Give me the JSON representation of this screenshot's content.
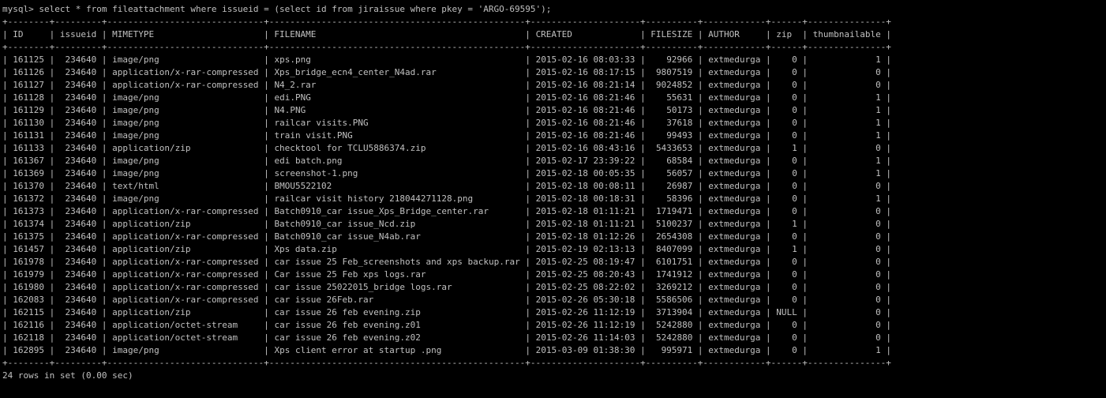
{
  "terminal": {
    "prompt": "mysql>",
    "command": "select * from fileattachment where issueid = (select id from jiraissue where pkey = 'ARGO-69595');",
    "columns": [
      "ID",
      "issueid",
      "MIMETYPE",
      "FILENAME",
      "CREATED",
      "FILESIZE",
      "AUTHOR",
      "zip",
      "thumbnailable"
    ],
    "rows": [
      [
        "161125",
        "234640",
        "image/png",
        "xps.png",
        "2015-02-16 08:03:33",
        "92966",
        "extmedurga",
        "0",
        "1"
      ],
      [
        "161126",
        "234640",
        "application/x-rar-compressed",
        "Xps_bridge_ecn4_center_N4ad.rar",
        "2015-02-16 08:17:15",
        "9807519",
        "extmedurga",
        "0",
        "0"
      ],
      [
        "161127",
        "234640",
        "application/x-rar-compressed",
        "N4_2.rar",
        "2015-02-16 08:21:14",
        "9024852",
        "extmedurga",
        "0",
        "0"
      ],
      [
        "161128",
        "234640",
        "image/png",
        "edi.PNG",
        "2015-02-16 08:21:46",
        "55631",
        "extmedurga",
        "0",
        "1"
      ],
      [
        "161129",
        "234640",
        "image/png",
        "N4.PNG",
        "2015-02-16 08:21:46",
        "50173",
        "extmedurga",
        "0",
        "1"
      ],
      [
        "161130",
        "234640",
        "image/png",
        "railcar visits.PNG",
        "2015-02-16 08:21:46",
        "37618",
        "extmedurga",
        "0",
        "1"
      ],
      [
        "161131",
        "234640",
        "image/png",
        "train visit.PNG",
        "2015-02-16 08:21:46",
        "99493",
        "extmedurga",
        "0",
        "1"
      ],
      [
        "161133",
        "234640",
        "application/zip",
        "checktool for TCLU5886374.zip",
        "2015-02-16 08:43:16",
        "5433653",
        "extmedurga",
        "1",
        "0"
      ],
      [
        "161367",
        "234640",
        "image/png",
        "edi batch.png",
        "2015-02-17 23:39:22",
        "68584",
        "extmedurga",
        "0",
        "1"
      ],
      [
        "161369",
        "234640",
        "image/png",
        "screenshot-1.png",
        "2015-02-18 00:05:35",
        "56057",
        "extmedurga",
        "0",
        "1"
      ],
      [
        "161370",
        "234640",
        "text/html",
        "BMOU5522102",
        "2015-02-18 00:08:11",
        "26987",
        "extmedurga",
        "0",
        "0"
      ],
      [
        "161372",
        "234640",
        "image/png",
        "railcar visit history 218044271128.png",
        "2015-02-18 00:18:31",
        "58396",
        "extmedurga",
        "0",
        "1"
      ],
      [
        "161373",
        "234640",
        "application/x-rar-compressed",
        "Batch0910_car issue_Xps_Bridge_center.rar",
        "2015-02-18 01:11:21",
        "1719471",
        "extmedurga",
        "0",
        "0"
      ],
      [
        "161374",
        "234640",
        "application/zip",
        "Batch0910_car issue_Ncd.zip",
        "2015-02-18 01:11:21",
        "5100237",
        "extmedurga",
        "1",
        "0"
      ],
      [
        "161375",
        "234640",
        "application/x-rar-compressed",
        "Batch0910_car issue_N4ab.rar",
        "2015-02-18 01:12:26",
        "2654308",
        "extmedurga",
        "0",
        "0"
      ],
      [
        "161457",
        "234640",
        "application/zip",
        "Xps data.zip",
        "2015-02-19 02:13:13",
        "8407099",
        "extmedurga",
        "1",
        "0"
      ],
      [
        "161978",
        "234640",
        "application/x-rar-compressed",
        "car issue 25 Feb_screenshots and xps backup.rar",
        "2015-02-25 08:19:47",
        "6101751",
        "extmedurga",
        "0",
        "0"
      ],
      [
        "161979",
        "234640",
        "application/x-rar-compressed",
        "Car issue 25 Feb xps logs.rar",
        "2015-02-25 08:20:43",
        "1741912",
        "extmedurga",
        "0",
        "0"
      ],
      [
        "161980",
        "234640",
        "application/x-rar-compressed",
        "car issue 25022015_bridge logs.rar",
        "2015-02-25 08:22:02",
        "3269212",
        "extmedurga",
        "0",
        "0"
      ],
      [
        "162083",
        "234640",
        "application/x-rar-compressed",
        "car issue 26Feb.rar",
        "2015-02-26 05:30:18",
        "5586506",
        "extmedurga",
        "0",
        "0"
      ],
      [
        "162115",
        "234640",
        "application/zip",
        "car issue 26 feb evening.zip",
        "2015-02-26 11:12:19",
        "3713904",
        "extmedurga",
        "NULL",
        "0"
      ],
      [
        "162116",
        "234640",
        "application/octet-stream",
        "car issue 26 feb evening.z01",
        "2015-02-26 11:12:19",
        "5242880",
        "extmedurga",
        "0",
        "0"
      ],
      [
        "162118",
        "234640",
        "application/octet-stream",
        "car issue 26 feb evening.z02",
        "2015-02-26 11:14:03",
        "5242880",
        "extmedurga",
        "0",
        "0"
      ],
      [
        "162895",
        "234640",
        "image/png",
        "Xps client error at startup .png",
        "2015-03-09 01:38:30",
        "995971",
        "extmedurga",
        "0",
        "1"
      ]
    ],
    "summary": "24 rows in set (0.00 sec)",
    "colors": {
      "background": "#000000",
      "text": "#c0c0c0"
    }
  }
}
